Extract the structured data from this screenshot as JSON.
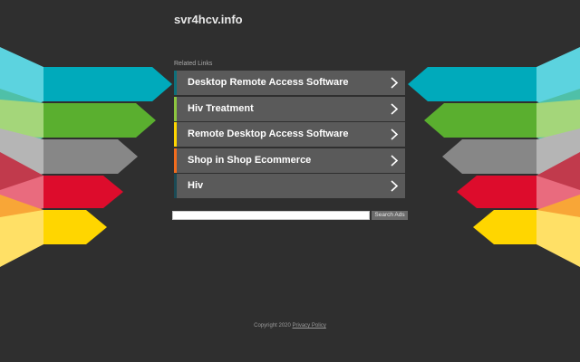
{
  "header": {
    "domain": "svr4hcv.info"
  },
  "related": {
    "title": "Related Links",
    "links": [
      {
        "label": "Desktop Remote Access Software",
        "accent": "#0e6f7a"
      },
      {
        "label": "Hiv Treatment",
        "accent": "#8cc63f"
      },
      {
        "label": "Remote Desktop Access Software",
        "accent": "#ffd600"
      },
      {
        "label": "Shop in Shop Ecommerce",
        "accent": "#f26c1d"
      },
      {
        "label": "Hiv",
        "accent": "#1a4a55"
      }
    ]
  },
  "search": {
    "placeholder": "",
    "button_label": "Search Ads"
  },
  "footer": {
    "copyright": "Copyright 2020",
    "privacy_label": "Privacy Policy"
  },
  "colors": {
    "background": "#2f2f2f",
    "link_bg": "#5a5a5a",
    "arrows": [
      "#00aabb",
      "#5aaf2f",
      "#878787",
      "#dd0c2c",
      "#ffd600"
    ]
  }
}
